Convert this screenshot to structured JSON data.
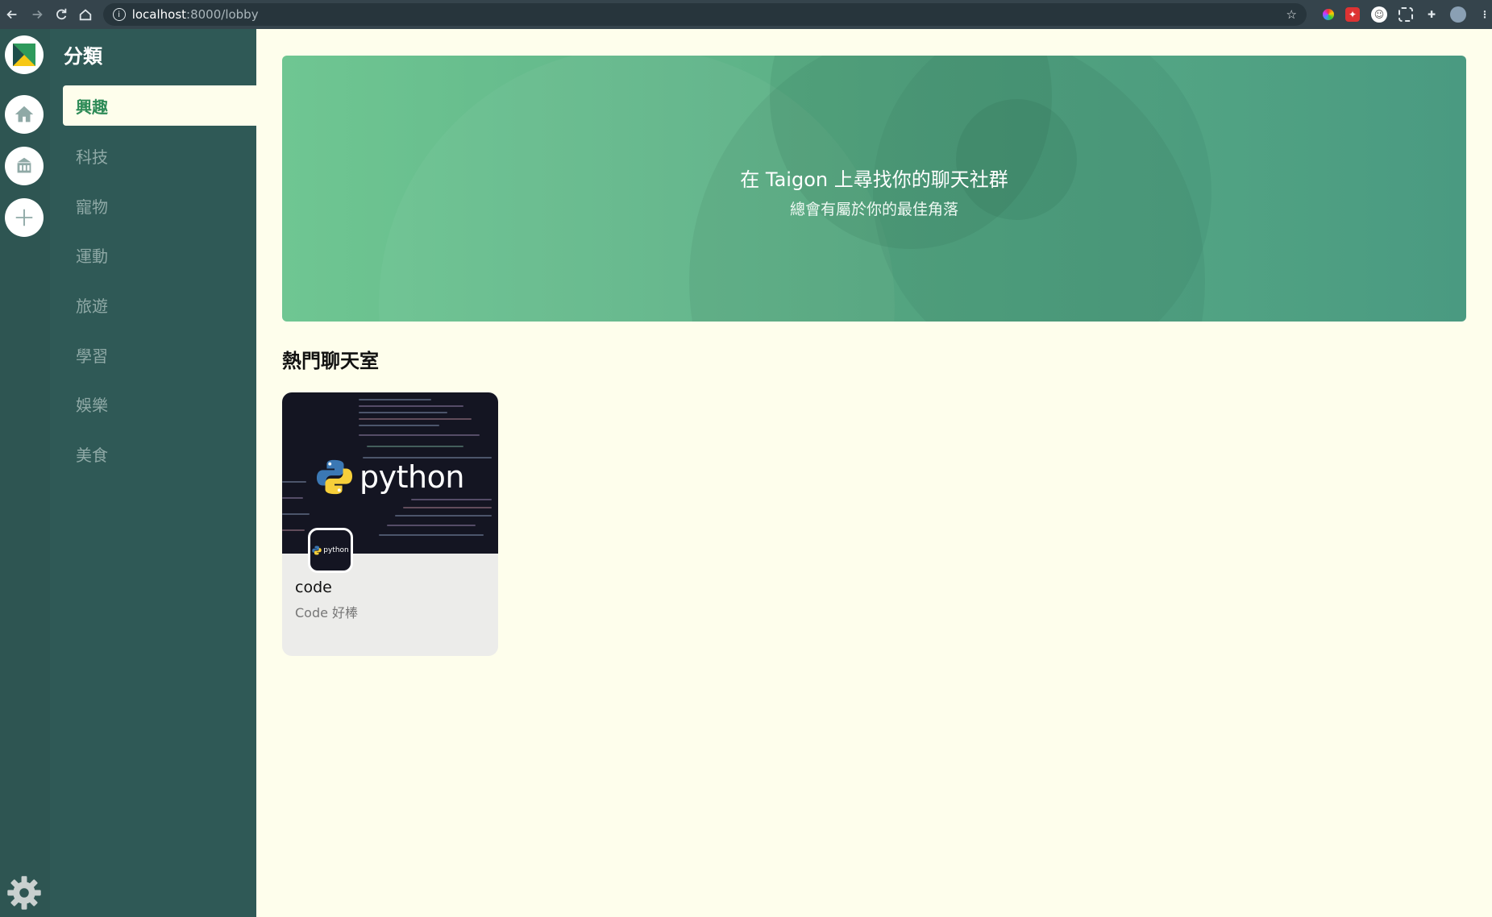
{
  "browser": {
    "url_host": "localhost",
    "url_rest": ":8000/lobby"
  },
  "sidebar": {
    "title": "分類",
    "items": [
      {
        "label": "興趣",
        "active": true
      },
      {
        "label": "科技",
        "active": false
      },
      {
        "label": "寵物",
        "active": false
      },
      {
        "label": "運動",
        "active": false
      },
      {
        "label": "旅遊",
        "active": false
      },
      {
        "label": "學習",
        "active": false
      },
      {
        "label": "娛樂",
        "active": false
      },
      {
        "label": "美食",
        "active": false
      }
    ]
  },
  "rail": {
    "icons": [
      "app-logo-icon",
      "home-icon",
      "school-building-icon",
      "plus-icon",
      "gear-icon"
    ]
  },
  "hero": {
    "title": "在 Taigon 上尋找你的聊天社群",
    "subtitle": "總會有屬於你的最佳角落"
  },
  "popular": {
    "title": "熱門聊天室",
    "rooms": [
      {
        "name": "code",
        "description": "Code 好棒",
        "cover_text": "python",
        "avatar_text": "python"
      }
    ]
  },
  "colors": {
    "rail": "#2e5552",
    "sidebar": "#2f5956",
    "accent": "#2e8b57",
    "page_bg": "#fefeec",
    "hero_start": "#6fc692",
    "hero_end": "#4a9a81"
  }
}
